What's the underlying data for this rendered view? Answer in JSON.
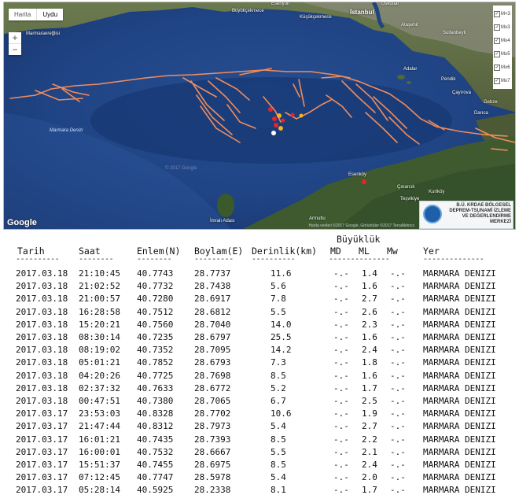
{
  "map": {
    "maptype": {
      "map_label": "Harita",
      "satellite_label": "Uydu"
    },
    "zoom": {
      "in": "+",
      "out": "−"
    },
    "legend_items": [
      {
        "label": "M<3",
        "checked": true
      },
      {
        "label": "M≥3",
        "checked": true
      },
      {
        "label": "M≥4",
        "checked": true
      },
      {
        "label": "M≥5",
        "checked": true
      },
      {
        "label": "M≥6",
        "checked": true
      },
      {
        "label": "M≥7",
        "checked": true
      }
    ],
    "place_labels": {
      "esenyurt": "Esenyurt",
      "buyukcekmece": "Büyükçekmece",
      "kucukcekmece": "Küçükçekmece",
      "istanbul": "İstanbul",
      "uskudar": "Üsküdar",
      "atasehir": "Ataşehir",
      "sultanbeyli": "Sultanbeyli",
      "marmaraereglisi": "Marmaraereğlisi",
      "adalar": "Adalar",
      "pendik": "Pendik",
      "gebze": "Gebze",
      "cayirova": "Çayırova",
      "darica": "Darıca",
      "cinarcik": "Çınarcık",
      "esenkoy": "Esenköy",
      "tesvikiye": "Teşvikiye",
      "kurtkoy": "Kurtköy",
      "armutlu": "Armutlu",
      "imrali": "İmralı Adası",
      "marmara_sea": "Marmara Denizi"
    },
    "google_logo": "Google",
    "attribution": "Harita verileri ©2017 Google, Görüntüler ©2017 TerraMetrics",
    "watermark": "© 2017 Google",
    "institution_logo": "B.Ü. KRDAE BÖLGESEL DEPREM-TSUNAMİ İZLEME VE DEĞERLENDİRME MERKEZİ",
    "colors": {
      "fault_line": "#f28c5a",
      "epicenter_red": "#e8242a",
      "epicenter_yellow": "#f5b324",
      "sea": "#1c3e79",
      "land": "#5a6a3e"
    }
  },
  "table": {
    "group_header": "Büyüklük",
    "columns": [
      "Tarih",
      "Saat",
      "Enlem(N)",
      "Boylam(E)",
      "Derinlik(km)",
      "MD",
      "ML",
      "Mw",
      "Yer"
    ],
    "rows": [
      {
        "tarih": "2017.03.18",
        "saat": "21:10:45",
        "enlem": "40.7743",
        "boylam": "28.7737",
        "derinlik": "11.6",
        "md": "-.-",
        "ml": "1.4",
        "mw": "-.-",
        "yer": "MARMARA DENIZI"
      },
      {
        "tarih": "2017.03.18",
        "saat": "21:02:52",
        "enlem": "40.7732",
        "boylam": "28.7438",
        "derinlik": "5.6",
        "md": "-.-",
        "ml": "1.6",
        "mw": "-.-",
        "yer": "MARMARA DENIZI"
      },
      {
        "tarih": "2017.03.18",
        "saat": "21:00:57",
        "enlem": "40.7280",
        "boylam": "28.6917",
        "derinlik": "7.8",
        "md": "-.-",
        "ml": "2.7",
        "mw": "-.-",
        "yer": "MARMARA DENIZI"
      },
      {
        "tarih": "2017.03.18",
        "saat": "16:28:58",
        "enlem": "40.7512",
        "boylam": "28.6812",
        "derinlik": "5.5",
        "md": "-.-",
        "ml": "2.6",
        "mw": "-.-",
        "yer": "MARMARA DENIZI"
      },
      {
        "tarih": "2017.03.18",
        "saat": "15:20:21",
        "enlem": "40.7560",
        "boylam": "28.7040",
        "derinlik": "14.0",
        "md": "-.-",
        "ml": "2.3",
        "mw": "-.-",
        "yer": "MARMARA DENIZI"
      },
      {
        "tarih": "2017.03.18",
        "saat": "08:30:14",
        "enlem": "40.7235",
        "boylam": "28.6797",
        "derinlik": "25.5",
        "md": "-.-",
        "ml": "1.6",
        "mw": "-.-",
        "yer": "MARMARA DENIZI"
      },
      {
        "tarih": "2017.03.18",
        "saat": "08:19:02",
        "enlem": "40.7352",
        "boylam": "28.7095",
        "derinlik": "14.2",
        "md": "-.-",
        "ml": "2.4",
        "mw": "-.-",
        "yer": "MARMARA DENIZI"
      },
      {
        "tarih": "2017.03.18",
        "saat": "05:01:21",
        "enlem": "40.7852",
        "boylam": "28.6793",
        "derinlik": "7.3",
        "md": "-.-",
        "ml": "1.8",
        "mw": "-.-",
        "yer": "MARMARA DENIZI"
      },
      {
        "tarih": "2017.03.18",
        "saat": "04:20:26",
        "enlem": "40.7725",
        "boylam": "28.7698",
        "derinlik": "8.5",
        "md": "-.-",
        "ml": "1.6",
        "mw": "-.-",
        "yer": "MARMARA DENIZI"
      },
      {
        "tarih": "2017.03.18",
        "saat": "02:37:32",
        "enlem": "40.7633",
        "boylam": "28.6772",
        "derinlik": "5.2",
        "md": "-.-",
        "ml": "1.7",
        "mw": "-.-",
        "yer": "MARMARA DENIZI"
      },
      {
        "tarih": "2017.03.18",
        "saat": "00:47:51",
        "enlem": "40.7380",
        "boylam": "28.7065",
        "derinlik": "6.7",
        "md": "-.-",
        "ml": "2.5",
        "mw": "-.-",
        "yer": "MARMARA DENIZI"
      },
      {
        "tarih": "2017.03.17",
        "saat": "23:53:03",
        "enlem": "40.8328",
        "boylam": "28.7702",
        "derinlik": "10.6",
        "md": "-.-",
        "ml": "1.9",
        "mw": "-.-",
        "yer": "MARMARA DENIZI"
      },
      {
        "tarih": "2017.03.17",
        "saat": "21:47:44",
        "enlem": "40.8312",
        "boylam": "28.7973",
        "derinlik": "5.4",
        "md": "-.-",
        "ml": "2.7",
        "mw": "-.-",
        "yer": "MARMARA DENIZI"
      },
      {
        "tarih": "2017.03.17",
        "saat": "16:01:21",
        "enlem": "40.7435",
        "boylam": "28.7393",
        "derinlik": "8.5",
        "md": "-.-",
        "ml": "2.2",
        "mw": "-.-",
        "yer": "MARMARA DENIZI"
      },
      {
        "tarih": "2017.03.17",
        "saat": "16:00:01",
        "enlem": "40.7532",
        "boylam": "28.6667",
        "derinlik": "5.5",
        "md": "-.-",
        "ml": "2.1",
        "mw": "-.-",
        "yer": "MARMARA DENIZI"
      },
      {
        "tarih": "2017.03.17",
        "saat": "15:51:37",
        "enlem": "40.7455",
        "boylam": "28.6975",
        "derinlik": "8.5",
        "md": "-.-",
        "ml": "2.4",
        "mw": "-.-",
        "yer": "MARMARA DENIZI"
      },
      {
        "tarih": "2017.03.17",
        "saat": "07:12:45",
        "enlem": "40.7747",
        "boylam": "28.5978",
        "derinlik": "5.4",
        "md": "-.-",
        "ml": "2.0",
        "mw": "-.-",
        "yer": "MARMARA DENIZI"
      },
      {
        "tarih": "2017.03.17",
        "saat": "05:28:14",
        "enlem": "40.5925",
        "boylam": "28.2338",
        "derinlik": "8.1",
        "md": "-.-",
        "ml": "1.7",
        "mw": "-.-",
        "yer": "MARMARA DENIZI"
      }
    ]
  }
}
